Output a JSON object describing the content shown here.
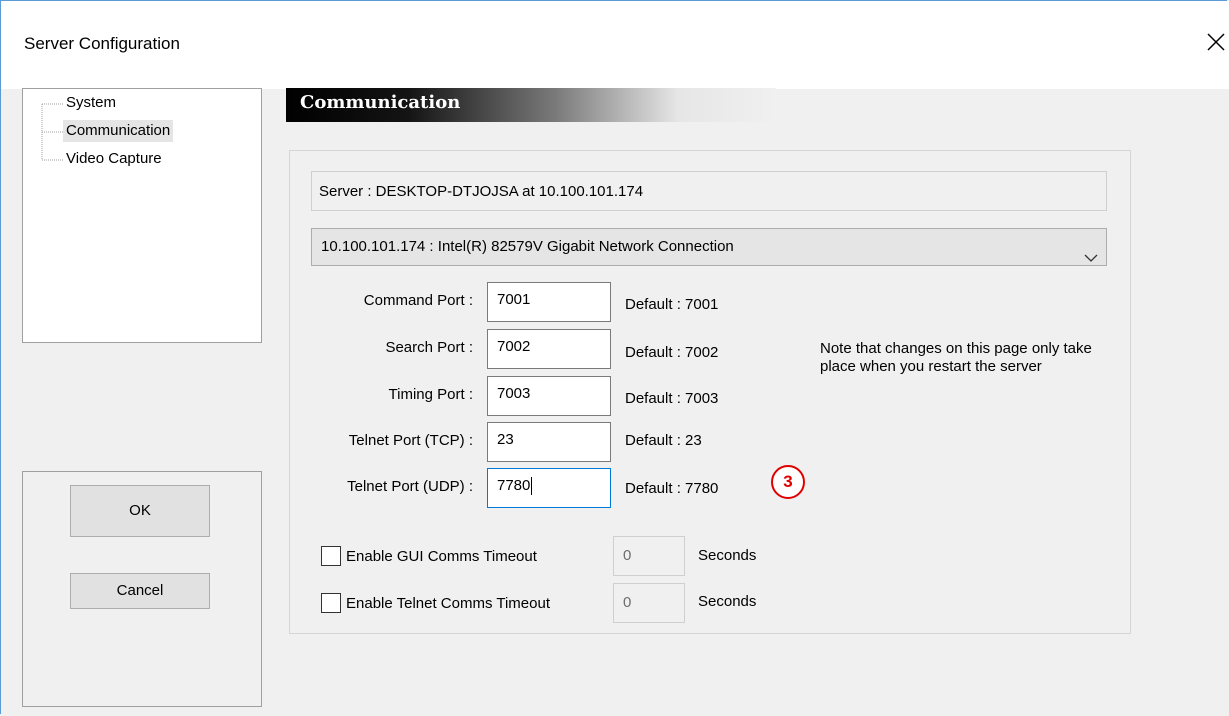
{
  "window": {
    "title": "Server Configuration"
  },
  "tree": {
    "items": [
      "System",
      "Communication",
      "Video Capture"
    ],
    "selected": "Communication"
  },
  "buttons": {
    "ok": "OK",
    "cancel": "Cancel"
  },
  "section": {
    "title": "Communication"
  },
  "server_info": "Server : DESKTOP-DTJOJSA  at  10.100.101.174",
  "network_select": {
    "value": "10.100.101.174 : Intel(R) 82579V Gigabit Network Connection"
  },
  "ports": [
    {
      "label": "Command Port :",
      "value": "7001",
      "default": "Default : 7001"
    },
    {
      "label": "Search Port :",
      "value": "7002",
      "default": "Default : 7002"
    },
    {
      "label": "Timing Port :",
      "value": "7003",
      "default": "Default : 7003"
    },
    {
      "label": "Telnet Port (TCP) :",
      "value": "23",
      "default": "Default : 23"
    },
    {
      "label": "Telnet Port (UDP) :",
      "value": "7780",
      "default": "Default : 7780"
    }
  ],
  "note": "Note that changes on this page only take place when you restart the server",
  "step_badge": "3",
  "timeouts": [
    {
      "label": "Enable GUI Comms Timeout",
      "checked": false,
      "value": "0",
      "unit": "Seconds"
    },
    {
      "label": "Enable Telnet Comms Timeout",
      "checked": false,
      "value": "0",
      "unit": "Seconds"
    }
  ],
  "colors": {
    "focus_border": "#0078d7",
    "badge_red": "#e00000",
    "window_border": "#5b9bd5"
  }
}
